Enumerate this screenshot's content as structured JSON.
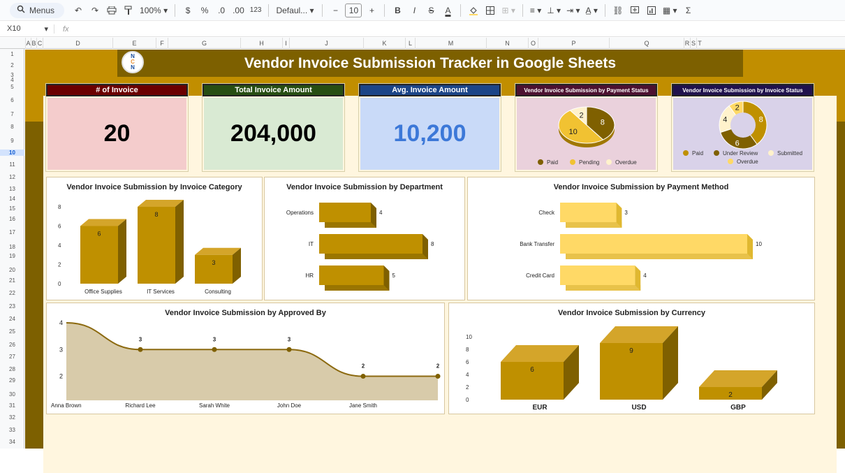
{
  "toolbar": {
    "menus_label": "Menus",
    "zoom": "100%",
    "currency": "$",
    "percent": "%",
    "dec_decrease": ".0",
    "dec_increase": ".00",
    "number_format": "123",
    "font": "Defaul...",
    "font_size": "10",
    "minus": "−",
    "plus": "+",
    "bold": "B",
    "italic": "I",
    "strike": "S",
    "text_color": "A",
    "sigma": "Σ"
  },
  "formula_bar": {
    "cell_ref": "X10",
    "fx": "fx"
  },
  "columns": [
    "A",
    "B",
    "C",
    "D",
    "E",
    "F",
    "G",
    "H",
    "I",
    "J",
    "K",
    "L",
    "M",
    "N",
    "O",
    "P",
    "Q",
    "R",
    "S",
    "T"
  ],
  "rows": [
    "1",
    "2",
    "3",
    "4",
    "5",
    "6",
    "7",
    "8",
    "9",
    "10",
    "11",
    "12",
    "13",
    "14",
    "15",
    "16",
    "17",
    "18",
    "19",
    "20",
    "21",
    "22",
    "23",
    "24",
    "25",
    "26",
    "27",
    "28",
    "29",
    "30",
    "31",
    "32",
    "33",
    "34"
  ],
  "dashboard": {
    "title": "Vendor Invoice Submission Tracker in Google Sheets",
    "logo_text": [
      "N",
      "C",
      "N"
    ],
    "kpis": [
      {
        "label": "# of Invoice",
        "value": "20",
        "header_color": "#6b0000",
        "body_color": "#f4cccc",
        "value_color": "#000000"
      },
      {
        "label": "Total Invoice Amount",
        "value": "204,000",
        "header_color": "#274e13",
        "body_color": "#d9ead3",
        "value_color": "#000000"
      },
      {
        "label": "Avg. Invoice Amount",
        "value": "10,200",
        "header_color": "#1c4587",
        "body_color": "#c9daf8",
        "value_color": "#3c78d8"
      }
    ],
    "payment_status": {
      "title": "Vendor Invoice Submission by Payment Status",
      "header_color": "#4c1130",
      "body_color": "#ead1dc"
    },
    "invoice_status": {
      "title": "Vendor Invoice Submission by Invoice Status",
      "header_color": "#20124d",
      "body_color": "#d9d2e9"
    }
  },
  "colors": {
    "gold": "#bf9000",
    "dark_gold": "#7f6000",
    "light_gold": "#ffd966",
    "cream": "#fff2cc"
  },
  "chart_data": [
    {
      "type": "pie",
      "title": "Vendor Invoice Submission by Payment Status",
      "categories": [
        "Paid",
        "Pending",
        "Overdue"
      ],
      "values": [
        8,
        10,
        2
      ],
      "colors": [
        "#7f6000",
        "#f1c232",
        "#fff2cc"
      ],
      "legend": "bottom"
    },
    {
      "type": "pie",
      "title": "Vendor Invoice Submission by Invoice Status",
      "categories": [
        "Paid",
        "Under Review",
        "Submitted",
        "Overdue"
      ],
      "values": [
        8,
        6,
        4,
        2
      ],
      "colors": [
        "#bf9000",
        "#7f6000",
        "#fff2cc",
        "#ffd966"
      ],
      "legend": "bottom"
    },
    {
      "type": "bar",
      "title": "Vendor Invoice Submission by Invoice Category",
      "categories": [
        "Office Supplies",
        "IT Services",
        "Consulting"
      ],
      "values": [
        6,
        8,
        3
      ],
      "ylim": [
        0,
        8
      ],
      "yticks": [
        "0",
        "2",
        "4",
        "6",
        "8"
      ]
    },
    {
      "type": "bar",
      "orientation": "horizontal",
      "title": "Vendor Invoice Submission by Department",
      "categories": [
        "Operations",
        "IT",
        "HR"
      ],
      "values": [
        4,
        8,
        5
      ]
    },
    {
      "type": "bar",
      "orientation": "horizontal",
      "title": "Vendor Invoice Submission by Payment Method",
      "categories": [
        "Check",
        "Bank Transfer",
        "Credit Card"
      ],
      "values": [
        3,
        10,
        4
      ]
    },
    {
      "type": "area",
      "title": "Vendor Invoice Submission by Approved By",
      "categories": [
        "Anna Brown",
        "Richard Lee",
        "Sarah White",
        "John Doe",
        "Jane Smith",
        ""
      ],
      "values": [
        4,
        3,
        3,
        3,
        2,
        2
      ],
      "ylim": [
        0,
        4
      ],
      "yticks": [
        "2",
        "3",
        "4"
      ]
    },
    {
      "type": "bar",
      "title": "Vendor Invoice Submission by Currency",
      "categories": [
        "EUR",
        "USD",
        "GBP"
      ],
      "values": [
        6,
        9,
        2
      ],
      "ylim": [
        0,
        10
      ],
      "yticks": [
        "0",
        "2",
        "4",
        "6",
        "8",
        "10"
      ]
    }
  ]
}
